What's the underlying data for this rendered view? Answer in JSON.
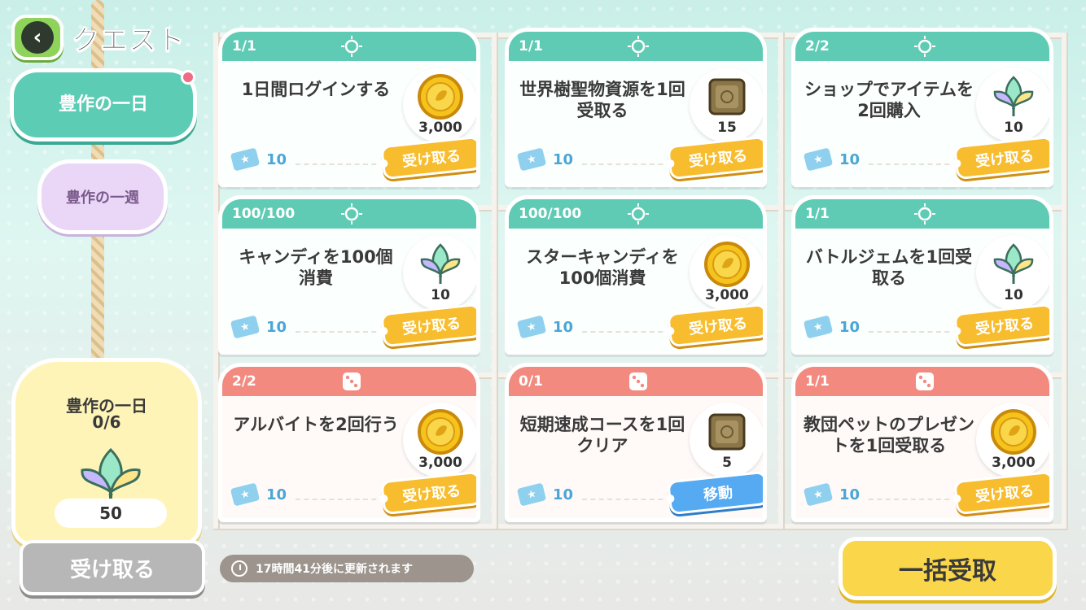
{
  "header": {
    "title": "クエスト",
    "back_icon": "chevron-left-icon"
  },
  "tabs": {
    "daily_label": "豊作の一日",
    "weekly_label": "豊作の一週"
  },
  "summary": {
    "title": "豊作の一日",
    "progress": "0/6",
    "reward_count": "50",
    "claim_label": "受け取る"
  },
  "quests": [
    {
      "count": "1/1",
      "text": "1日間ログインする",
      "reward_amount": "3,000",
      "reward_icon": "coin-icon",
      "ticket": "10",
      "button": "受け取る",
      "theme": "green"
    },
    {
      "count": "1/1",
      "text": "世界樹聖物資源を1回受取る",
      "reward_amount": "15",
      "reward_icon": "material-block-icon",
      "ticket": "10",
      "button": "受け取る",
      "theme": "green"
    },
    {
      "count": "2/2",
      "text": "ショップでアイテムを2回購入",
      "reward_amount": "10",
      "reward_icon": "crystal-leaf-icon",
      "ticket": "10",
      "button": "受け取る",
      "theme": "green"
    },
    {
      "count": "100/100",
      "text": "キャンディを100個消費",
      "reward_amount": "10",
      "reward_icon": "crystal-leaf-icon",
      "ticket": "10",
      "button": "受け取る",
      "theme": "green"
    },
    {
      "count": "100/100",
      "text": "スターキャンディを100個消費",
      "reward_amount": "3,000",
      "reward_icon": "coin-icon",
      "ticket": "10",
      "button": "受け取る",
      "theme": "green"
    },
    {
      "count": "1/1",
      "text": "バトルジェムを1回受取る",
      "reward_amount": "10",
      "reward_icon": "crystal-leaf-icon",
      "ticket": "10",
      "button": "受け取る",
      "theme": "green"
    },
    {
      "count": "2/2",
      "text": "アルバイトを2回行う",
      "reward_amount": "3,000",
      "reward_icon": "coin-icon",
      "ticket": "10",
      "button": "受け取る",
      "theme": "red"
    },
    {
      "count": "0/1",
      "text": "短期速成コースを1回クリア",
      "reward_amount": "5",
      "reward_icon": "material-block-icon",
      "ticket": "10",
      "button": "移動",
      "theme": "red"
    },
    {
      "count": "1/1",
      "text": "教団ペットのプレゼントを1回受取る",
      "reward_amount": "3,000",
      "reward_icon": "coin-icon",
      "ticket": "10",
      "button": "受け取る",
      "theme": "red"
    }
  ],
  "footer": {
    "refresh_text": "17時間41分後に更新されます",
    "claim_all_label": "一括受取"
  },
  "colors": {
    "green_header": "#5fcbb4",
    "red_header": "#f28a80",
    "claim_button": "#f7bd2e",
    "move_button": "#55aaf2"
  }
}
